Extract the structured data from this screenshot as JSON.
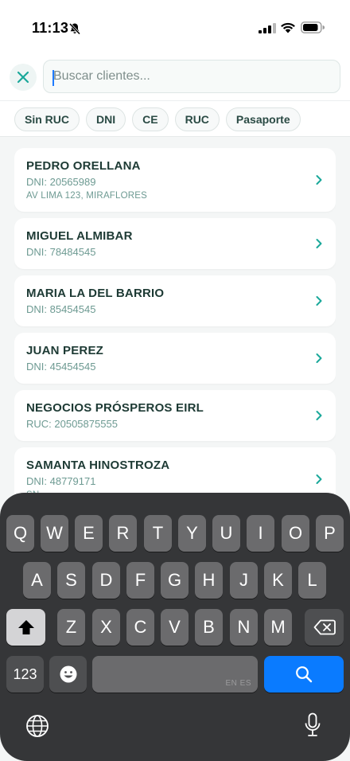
{
  "status_bar": {
    "time": "11:13"
  },
  "search": {
    "placeholder": "Buscar clientes...",
    "value": ""
  },
  "filters": [
    "Sin RUC",
    "DNI",
    "CE",
    "RUC",
    "Pasaporte"
  ],
  "clients": [
    {
      "name": "PEDRO ORELLANA",
      "doc": "DNI: 20565989",
      "address": "AV LIMA 123, MIRAFLORES"
    },
    {
      "name": "MIGUEL ALMIBAR",
      "doc": "DNI: 78484545"
    },
    {
      "name": "MARIA LA DEL BARRIO",
      "doc": "DNI: 85454545"
    },
    {
      "name": "JUAN PEREZ",
      "doc": "DNI: 45454545"
    },
    {
      "name": "NEGOCIOS PRÓSPEROS EIRL",
      "doc": "RUC: 20505875555"
    },
    {
      "name": "SAMANTA HINOSTROZA",
      "doc": "DNI: 48779171",
      "address": "SN"
    }
  ],
  "keyboard": {
    "row1": [
      "Q",
      "W",
      "E",
      "R",
      "T",
      "Y",
      "U",
      "I",
      "O",
      "P"
    ],
    "row2": [
      "A",
      "S",
      "D",
      "F",
      "G",
      "H",
      "J",
      "K",
      "L"
    ],
    "row3": [
      "Z",
      "X",
      "C",
      "V",
      "B",
      "N",
      "M"
    ],
    "numbers_label": "123",
    "space_languages": "EN ES",
    "icons": [
      "shift-icon",
      "backspace-icon",
      "emoji-icon",
      "search-icon",
      "globe-icon",
      "microphone-icon"
    ],
    "accent_color": "#0a7bff"
  },
  "colors": {
    "accent": "#1aa89a",
    "name_text": "#1d3a34",
    "doc_text": "#6d9a92"
  }
}
